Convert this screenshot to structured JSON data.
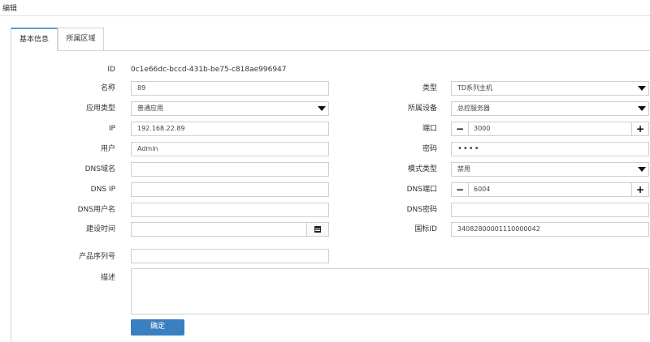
{
  "window": {
    "title": "编辑"
  },
  "tabs": [
    {
      "label": "基本信息",
      "active": true
    },
    {
      "label": "所属区域",
      "active": false
    }
  ],
  "form": {
    "id": {
      "label": "ID",
      "value": "0c1e66dc-bccd-431b-be75-c818ae996947"
    },
    "name": {
      "label": "名称",
      "value": "89"
    },
    "type": {
      "label": "类型",
      "value": "TD系列主机"
    },
    "app_type": {
      "label": "应用类型",
      "value": "普通应用"
    },
    "device": {
      "label": "所属设备",
      "value": "总控服务器"
    },
    "ip": {
      "label": "IP",
      "value": "192.168.22.89"
    },
    "port": {
      "label": "端口",
      "value": "3000"
    },
    "user": {
      "label": "用户",
      "value": "Admin"
    },
    "password": {
      "label": "密码",
      "value": "••••"
    },
    "dns_domain": {
      "label": "DNS域名",
      "value": ""
    },
    "mode_type": {
      "label": "模式类型",
      "value": "禁用"
    },
    "dns_ip": {
      "label": "DNS IP",
      "value": ""
    },
    "dns_port": {
      "label": "DNS端口",
      "value": "6004"
    },
    "dns_user": {
      "label": "DNS用户名",
      "value": ""
    },
    "dns_password": {
      "label": "DNS密码",
      "value": ""
    },
    "build_time": {
      "label": "建设时间",
      "value": ""
    },
    "national_id": {
      "label": "国标ID",
      "value": "34082800001110000042"
    },
    "serial": {
      "label": "产品序列号",
      "value": ""
    },
    "description": {
      "label": "描述",
      "value": ""
    }
  },
  "stepper": {
    "minus": "−",
    "plus": "+"
  },
  "confirm_label": "确定",
  "colors": {
    "accent": "#3a7fc0",
    "tab_active_border": "#5b9bd5"
  }
}
